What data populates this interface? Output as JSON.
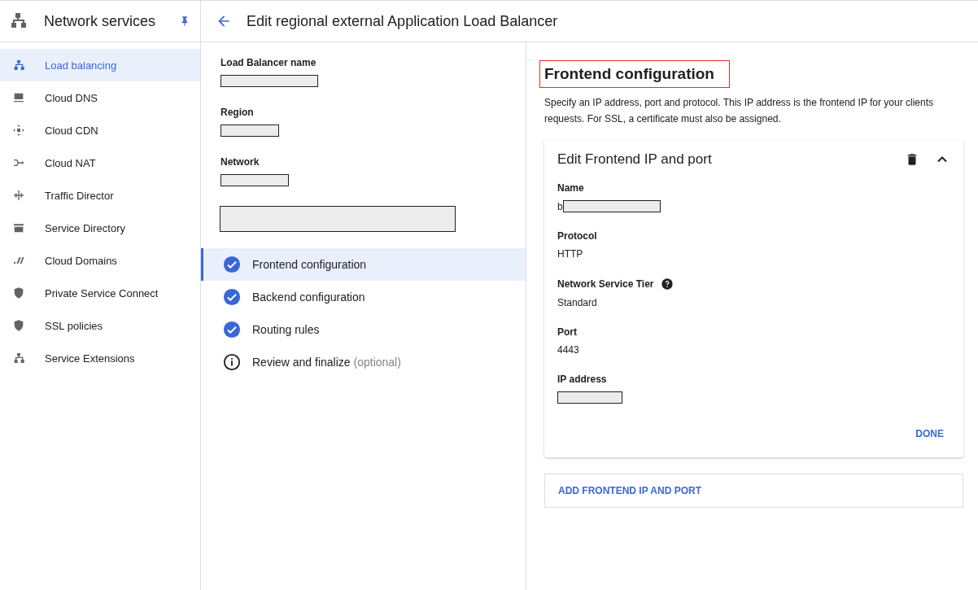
{
  "sidebar": {
    "title": "Network services",
    "pinned": true,
    "items": [
      {
        "label": "Load balancing",
        "selected": true
      },
      {
        "label": "Cloud DNS",
        "selected": false
      },
      {
        "label": "Cloud CDN",
        "selected": false
      },
      {
        "label": "Cloud NAT",
        "selected": false
      },
      {
        "label": "Traffic Director",
        "selected": false
      },
      {
        "label": "Service Directory",
        "selected": false
      },
      {
        "label": "Cloud Domains",
        "selected": false
      },
      {
        "label": "Private Service Connect",
        "selected": false
      },
      {
        "label": "SSL policies",
        "selected": false
      },
      {
        "label": "Service Extensions",
        "selected": false
      }
    ]
  },
  "header": {
    "title": "Edit regional external Application Load Balancer"
  },
  "summary": {
    "fields": [
      {
        "label": "Load Balancer name"
      },
      {
        "label": "Region"
      },
      {
        "label": "Network"
      }
    ]
  },
  "steps": [
    {
      "label": "Frontend configuration",
      "completed": true,
      "selected": true
    },
    {
      "label": "Backend configuration",
      "completed": true,
      "selected": false
    },
    {
      "label": "Routing rules",
      "completed": true,
      "selected": false
    },
    {
      "label": "Review and finalize",
      "note": "(optional)",
      "completed": false,
      "selected": false
    }
  ],
  "frontend": {
    "title": "Frontend configuration",
    "highlighted": true,
    "description": "Specify an IP address, port and protocol. This IP address is the frontend IP for your clients requests. For SSL, a certificate must also be assigned.",
    "card": {
      "title": "Edit Frontend IP and port",
      "expanded": true,
      "fields": [
        {
          "label": "Name",
          "value": "b",
          "redacted": true
        },
        {
          "label": "Protocol",
          "value": "HTTP"
        },
        {
          "label": "Network Service Tier",
          "value": "Standard",
          "help": true
        },
        {
          "label": "Port",
          "value": "4443"
        },
        {
          "label": "IP address",
          "redacted": true
        }
      ],
      "done": "DONE"
    },
    "add_button": "ADD FRONTEND IP AND PORT"
  }
}
